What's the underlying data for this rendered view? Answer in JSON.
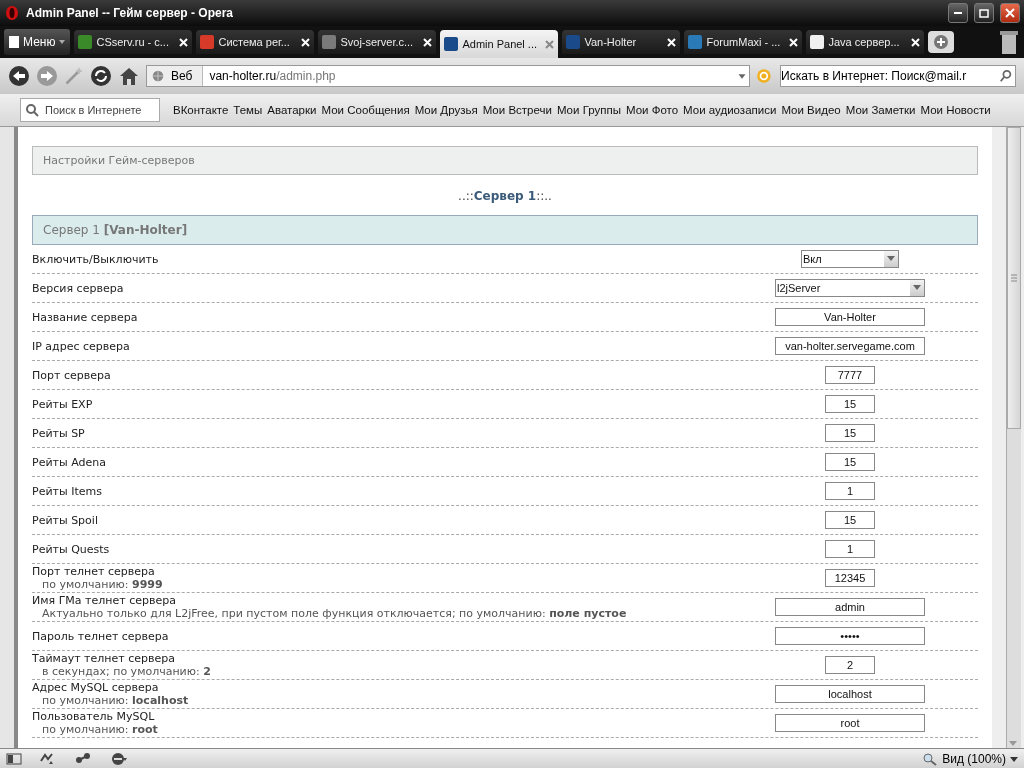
{
  "window": {
    "title": "Admin Panel -- Гейм сервер - Opera"
  },
  "menu_button": "Меню",
  "tabs": [
    {
      "label": "CSserv.ru - с...",
      "selected": false,
      "color": "#3a8a2a"
    },
    {
      "label": "Система рег...",
      "selected": false,
      "color": "#d83a2a"
    },
    {
      "label": "Svoj-server.c...",
      "selected": false,
      "color": "#7a7a7a"
    },
    {
      "label": "Admin Panel ...",
      "selected": true,
      "color": "#1a4a8a"
    },
    {
      "label": "Van-Holter",
      "selected": false,
      "color": "#1a4a8a"
    },
    {
      "label": "ForumMaxi - ...",
      "selected": false,
      "color": "#2a7ab8"
    },
    {
      "label": "Java сервер...",
      "selected": false,
      "color": "#f0f0f0"
    }
  ],
  "address_bar": {
    "scope": "Веб",
    "host": "van-holter.ru",
    "path": "/admin.php"
  },
  "search_box": {
    "value": "Искать в Интернет: Поиск@mail.r"
  },
  "bookmarks_bar": {
    "search_placeholder": "Поиск в Интернете",
    "links": [
      "ВКонтакте",
      "Темы",
      "Аватарки",
      "Мои Сообщения",
      "Мои Друзья",
      "Мои Встречи",
      "Мои Группы",
      "Мои Фото",
      "Мои аудиозаписи",
      "Мои Видео",
      "Мои Заметки",
      "Мои Новости"
    ]
  },
  "page": {
    "section_title": "Настройки Гейм-серверов",
    "server_heading_prefix": "..::",
    "server_heading": "Сервер 1",
    "server_heading_suffix": "::..",
    "server_box": "Сервер 1 **[Van-Holter]**",
    "rows": [
      {
        "label": "Включить/Выключить",
        "kind": "short-select",
        "value": "Вкл"
      },
      {
        "label": "Версия сервера",
        "kind": "select",
        "value": "l2jServer"
      },
      {
        "label": "Название сервера",
        "kind": "text",
        "value": "Van-Holter"
      },
      {
        "label": "IP адрес сервера",
        "kind": "text",
        "value": "van-holter.servegame.com"
      },
      {
        "label": "Порт сервера",
        "kind": "number",
        "value": "7777"
      },
      {
        "label": "Рейты EXP",
        "kind": "number",
        "value": "15"
      },
      {
        "label": "Рейты SP",
        "kind": "number",
        "value": "15"
      },
      {
        "label": "Рейты Adena",
        "kind": "number",
        "value": "15"
      },
      {
        "label": "Рейты Items",
        "kind": "number",
        "value": "1"
      },
      {
        "label": "Рейты Spoil",
        "kind": "number",
        "value": "15"
      },
      {
        "label": "Рейты Quests",
        "kind": "number",
        "value": "1"
      },
      {
        "label": "Порт телнет сервера",
        "hint": "по умолчанию: **9999**",
        "kind": "number",
        "value": "12345"
      },
      {
        "label": "Имя ГМа телнет сервера",
        "hint": "Актуально только для L2jFree, при пустом поле функция отключается; по умолчанию: **поле пустое**",
        "kind": "text",
        "value": "admin"
      },
      {
        "label": "Пароль телнет сервера",
        "kind": "password",
        "value": "•••••"
      },
      {
        "label": "Таймаут телнет сервера",
        "hint": "в секундах; по умолчанию: **2**",
        "kind": "number",
        "value": "2"
      },
      {
        "label": "Адрес MySQL сервера",
        "hint": "по умолчанию: **localhost**",
        "kind": "text",
        "value": "localhost"
      },
      {
        "label": "Пользователь MySQL",
        "hint": "по умолчанию: **root**",
        "kind": "text",
        "value": "root"
      }
    ]
  },
  "status_bar": {
    "zoom": "Вид (100%)"
  }
}
